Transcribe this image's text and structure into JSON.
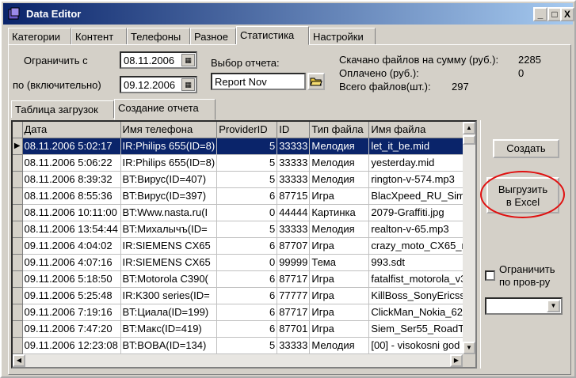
{
  "window": {
    "title": "Data Editor"
  },
  "title_buttons": {
    "minimize": "_",
    "maximize": "□",
    "close": "X"
  },
  "tabs": [
    "Категории",
    "Контент",
    "Телефоны",
    "Разное",
    "Статистика",
    "Настройки"
  ],
  "active_tab": "Статистика",
  "filters": {
    "limit_from_label": "Ограничить с",
    "date_from": "08.11.2006",
    "limit_to_label": "по (включительно)",
    "date_to": "09.12.2006",
    "report_label": "Выбор отчета:",
    "report_value": "Report Nov"
  },
  "summary": {
    "downloaded_label": "Скачано файлов на сумму (руб.):",
    "downloaded_value": "2285",
    "paid_label": "Оплачено (руб.):",
    "paid_value": "0",
    "total_label": "Всего файлов(шт.):",
    "total_value": "297"
  },
  "subtabs": [
    "Таблица загрузок",
    "Создание отчета"
  ],
  "active_subtab": "Создание отчета",
  "grid": {
    "columns": [
      "Дата",
      "Имя телефона",
      "ProviderID",
      "ID",
      "Тип файла",
      "Имя файла"
    ],
    "rows": [
      [
        "08.11.2006 5:02:17",
        "IR:Philips 655(ID=8)",
        "5",
        "33333",
        "Мелодия",
        "let_it_be.mid"
      ],
      [
        "08.11.2006 5:06:22",
        "IR:Philips 655(ID=8)",
        "5",
        "33333",
        "Мелодия",
        "yesterday.mid"
      ],
      [
        "08.11.2006 8:39:32",
        "BT:Вирус(ID=407)",
        "5",
        "33333",
        "Мелодия",
        "rington-v-574.mp3"
      ],
      [
        "08.11.2006 8:55:36",
        "BT:Вирус(ID=397)",
        "6",
        "87715",
        "Игра",
        "BlacXpeed_RU_Sim"
      ],
      [
        "08.11.2006 10:11:00",
        "BT:Www.nasta.ru(I",
        "0",
        "44444",
        "Картинка",
        "2079-Graffiti.jpg"
      ],
      [
        "08.11.2006 13:54:44",
        "BT:Михалычъ(ID=",
        "5",
        "33333",
        "Мелодия",
        "realton-v-65.mp3"
      ],
      [
        "09.11.2006 4:04:02",
        "IR:SIEMENS CX65",
        "6",
        "87707",
        "Игра",
        "crazy_moto_CX65_ru"
      ],
      [
        "09.11.2006 4:07:16",
        "IR:SIEMENS CX65",
        "0",
        "99999",
        "Тема",
        "993.sdt"
      ],
      [
        "09.11.2006 5:18:50",
        "BT:Motorola C390(",
        "6",
        "87717",
        "Игра",
        "fatalfist_motorola_v30"
      ],
      [
        "09.11.2006 5:25:48",
        "IR:K300 series(ID=",
        "6",
        "77777",
        "Игра",
        "KillBoss_SonyEricsso"
      ],
      [
        "09.11.2006 7:19:16",
        "BT:Циала(ID=199)",
        "6",
        "87717",
        "Игра",
        "ClickMan_Nokia_625"
      ],
      [
        "09.11.2006 7:47:20",
        "BT:Макс(ID=419)",
        "6",
        "87701",
        "Игра",
        "Siem_Ser55_RoadT"
      ],
      [
        "09.11.2006 12:23:08",
        "BT:BOBA(ID=134)",
        "5",
        "33333",
        "Мелодия",
        "[00] - visokosni god -"
      ]
    ],
    "selected_row": 0,
    "row_indicator": "▶"
  },
  "buttons": {
    "create": "Создать",
    "export_line1": "Выгрузить",
    "export_line2": "в Excel"
  },
  "provider_filter": {
    "label_line1": "Ограничить",
    "label_line2": "по пров-ру",
    "checked": false,
    "selected": ""
  },
  "colors": {
    "title_start": "#0a246a",
    "title_end": "#a6caf0",
    "selection": "#0a246a",
    "highlight_ellipse": "#e01010"
  }
}
